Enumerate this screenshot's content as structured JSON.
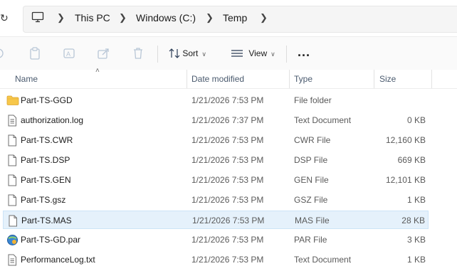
{
  "breadcrumb": {
    "items": [
      "This PC",
      "Windows (C:)",
      "Temp"
    ]
  },
  "toolbar": {
    "sort_label": "Sort",
    "view_label": "View",
    "more_label": "..."
  },
  "columns": {
    "name": "Name",
    "date": "Date modified",
    "type": "Type",
    "size": "Size"
  },
  "files": [
    {
      "name": "Part-TS-GGD",
      "date": "1/21/2026 7:53 PM",
      "type": "File folder",
      "size": "",
      "icon": "folder-icon"
    },
    {
      "name": "authorization.log",
      "date": "1/21/2026 7:37 PM",
      "type": "Text Document",
      "size": "0 KB",
      "icon": "text-file-icon"
    },
    {
      "name": "Part-TS.CWR",
      "date": "1/21/2026 7:53 PM",
      "type": "CWR File",
      "size": "12,160 KB",
      "icon": "file-icon"
    },
    {
      "name": "Part-TS.DSP",
      "date": "1/21/2026 7:53 PM",
      "type": "DSP File",
      "size": "669 KB",
      "icon": "file-icon"
    },
    {
      "name": "Part-TS.GEN",
      "date": "1/21/2026 7:53 PM",
      "type": "GEN File",
      "size": "12,101 KB",
      "icon": "file-icon"
    },
    {
      "name": "Part-TS.gsz",
      "date": "1/21/2026 7:53 PM",
      "type": "GSZ File",
      "size": "1 KB",
      "icon": "file-icon"
    },
    {
      "name": "Part-TS.MAS",
      "date": "1/21/2026 7:53 PM",
      "type": "MAS File",
      "size": "28 KB",
      "icon": "file-icon",
      "selected": true
    },
    {
      "name": "Part-TS-GD.par",
      "date": "1/21/2026 7:53 PM",
      "type": "PAR File",
      "size": "3 KB",
      "icon": "par-file-icon"
    },
    {
      "name": "PerformanceLog.txt",
      "date": "1/21/2026 7:53 PM",
      "type": "Text Document",
      "size": "1 KB",
      "icon": "text-file-icon"
    }
  ]
}
